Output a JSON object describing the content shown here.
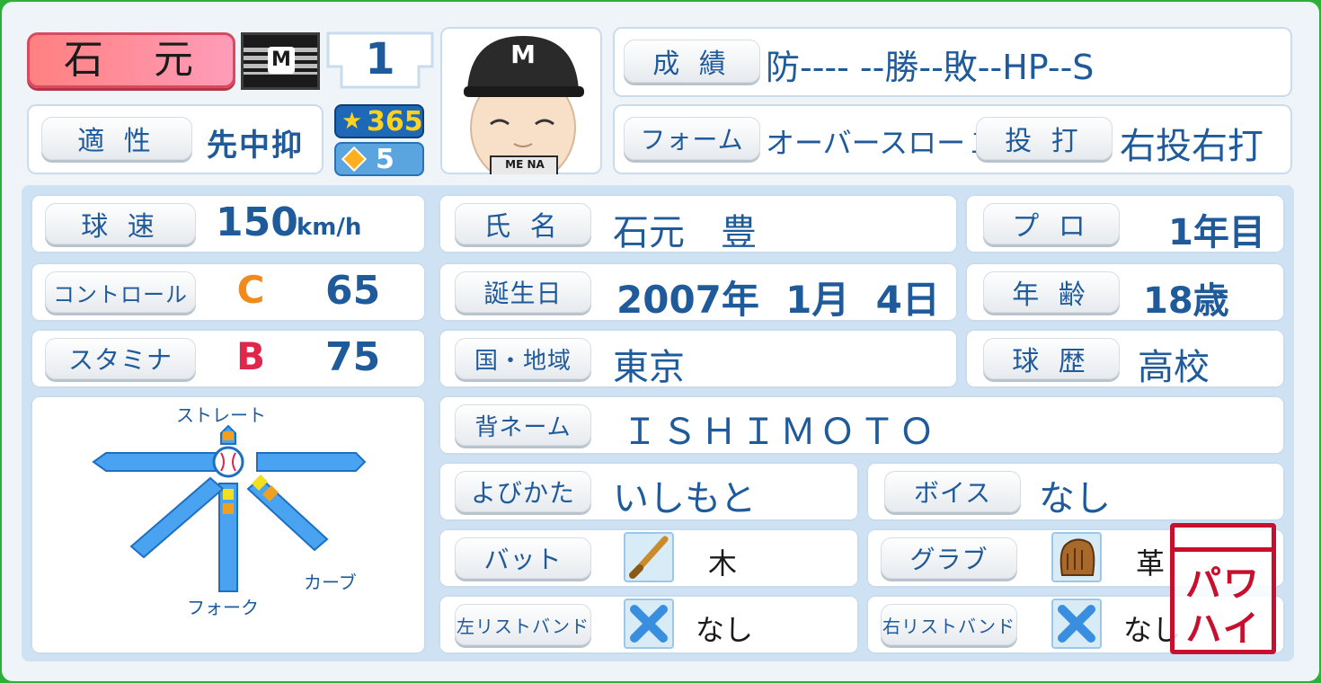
{
  "header": {
    "name": "石　元",
    "team_logo": "M",
    "uniform_number": "1",
    "aptitude_label": "適 性",
    "aptitude_value": "先中抑",
    "star_points": "365",
    "diamond_points": "5",
    "cap_letter": "M",
    "jersey_text": "ME NA"
  },
  "record": {
    "label": "成 績",
    "value": "防---- --勝--敗--HP--S"
  },
  "form": {
    "label": "フォーム",
    "value": "オーバースロー１４",
    "bat_label": "投 打",
    "bat_value": "右投右打"
  },
  "stats": {
    "speed_label": "球 速",
    "speed_value": "150",
    "speed_unit": "km/h",
    "control_label": "コントロール",
    "control_grade": "C",
    "control_value": "65",
    "stamina_label": "スタミナ",
    "stamina_grade": "B",
    "stamina_value": "75"
  },
  "pitches": {
    "straight": "ストレート",
    "curve": "カーブ",
    "fork": "フォーク"
  },
  "profile": {
    "name_label": "氏 名",
    "name_value": "石元　豊",
    "pro_label": "プ ロ",
    "pro_value": "1年目",
    "birth_label": "誕生日",
    "birth_value": "2007年  1月  4日",
    "age_label": "年 齢",
    "age_value": "18歳",
    "region_label": "国・地域",
    "region_value": "東京",
    "career_label": "球 歴",
    "career_value": "高校",
    "backname_label": "背ネーム",
    "backname_value": "ＩＳＨＩＭＯＴＯ",
    "reading_label": "よびかた",
    "reading_value": "いしもと",
    "voice_label": "ボイス",
    "voice_value": "なし",
    "bat_label": "バット",
    "bat_value": "木",
    "glove_label": "グラブ",
    "glove_value": "革",
    "lwrist_label": "左リストバンド",
    "lwrist_value": "なし",
    "rwrist_label": "右リストバンド",
    "rwrist_value": "なし"
  },
  "stamp": {
    "text_top": "パワ",
    "text_bottom": "ハイ"
  },
  "colors": {
    "name_plate": "#f26f86",
    "label_text": "#1f5a9a",
    "grade_c": "#f08a1c",
    "grade_b": "#e0264a",
    "stamp": "#c8102e",
    "frame": "#2fae3a"
  }
}
